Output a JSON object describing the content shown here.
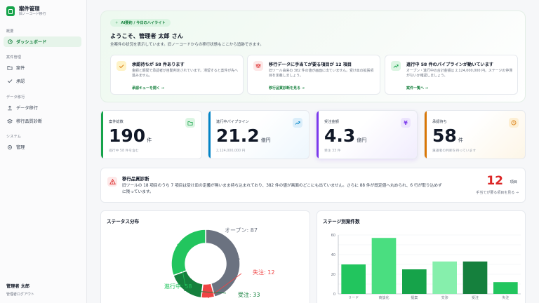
{
  "sidebar": {
    "brand_name": "案件管理",
    "brand_sub": "旧ノーコード移行",
    "sections": {
      "overview": "概要",
      "case_mgmt": "案件管理",
      "migration": "データ移行",
      "system": "システム"
    },
    "items": {
      "dashboard": "ダッシュボード",
      "cases": "案件",
      "approvals": "承認",
      "data_migration": "データ移行",
      "quality": "移行品質診断",
      "admin": "管理"
    },
    "user_name": "管理者 太郎",
    "user_sub": "管理者ログアウト"
  },
  "hero": {
    "pill": "AI要約 / 今日のハイライト",
    "title": "ようこそ、管理者 太郎 さん",
    "subtitle": "全案件の状況を表示しています。旧ノーコードからの移行状態もここから追跡できます。",
    "cards": [
      {
        "title": "承認待ちが 58 件あります",
        "desc": "金額と期間で承認者が自動判定されています。滞留すると案件が先へ進みません。",
        "link": "承認キューを開く →"
      },
      {
        "title": "移行データに手当てが要る項目が 12 項目",
        "desc": "旧ツール由来の 382 件の値が画面に出ていません。受け皿の拡張項目を定義しましょう。",
        "link": "移行品質診断を見る →"
      },
      {
        "title": "進行中 58 件のパイプラインが動いています",
        "desc": "オープン・進行中の合計金額は 2,124,000,000 円。ステージの停滞がないか確認しましょう。",
        "link": "案件一覧へ →"
      }
    ]
  },
  "kpis": [
    {
      "label": "案件総数",
      "value": "190",
      "unit": "件",
      "sub": "進行中 58 件を含む",
      "color": "#16a34a"
    },
    {
      "label": "進行中パイプライン",
      "value": "21.2",
      "unit": "億円",
      "sub": "2,124,000,000 円",
      "color": "#0284c7"
    },
    {
      "label": "受注金額",
      "value": "4.3",
      "unit": "億円",
      "sub": "受注 33 件",
      "color": "#7c3aed"
    },
    {
      "label": "承認待ち",
      "value": "58",
      "unit": "件",
      "sub": "稟議者の判断を待っています",
      "color": "#d97706"
    }
  ],
  "quality": {
    "title": "移行品質診断",
    "desc": "旧ツールの 18 項目のうち 7 項目は受け皿の定義が無いまま持ち込まれており、382 件の値が画面のどこにも出ていません。さらに 88 件が既定値へ丸められ、6 行が取り込めずに残っています。",
    "number": "12",
    "unit": "項目",
    "link": "手当てが要る項目を見る →"
  },
  "status_chart_title": "ステータス分布",
  "stage_chart_title": "ステージ別案件数",
  "chart_data": [
    {
      "type": "pie",
      "title": "ステータス分布",
      "categories": [
        "オープン",
        "失注",
        "受注",
        "進行中"
      ],
      "values": [
        87,
        12,
        33,
        58
      ],
      "colors": [
        "#6b7280",
        "#ef4444",
        "#15803d",
        "#22c55e"
      ],
      "legend": "labels-outside"
    },
    {
      "type": "bar",
      "title": "ステージ別案件数",
      "categories": [
        "リード",
        "商談化",
        "提案",
        "交渉",
        "受注",
        "失注"
      ],
      "values": [
        30,
        57,
        25,
        33,
        33,
        12
      ],
      "colors": [
        "#22c55e",
        "#4ade80",
        "#16a34a",
        "#86efac",
        "#15803d",
        "#22c55e"
      ],
      "ylim": [
        0,
        60
      ],
      "yticks": [
        0,
        20,
        40,
        60
      ],
      "grid": true
    }
  ]
}
